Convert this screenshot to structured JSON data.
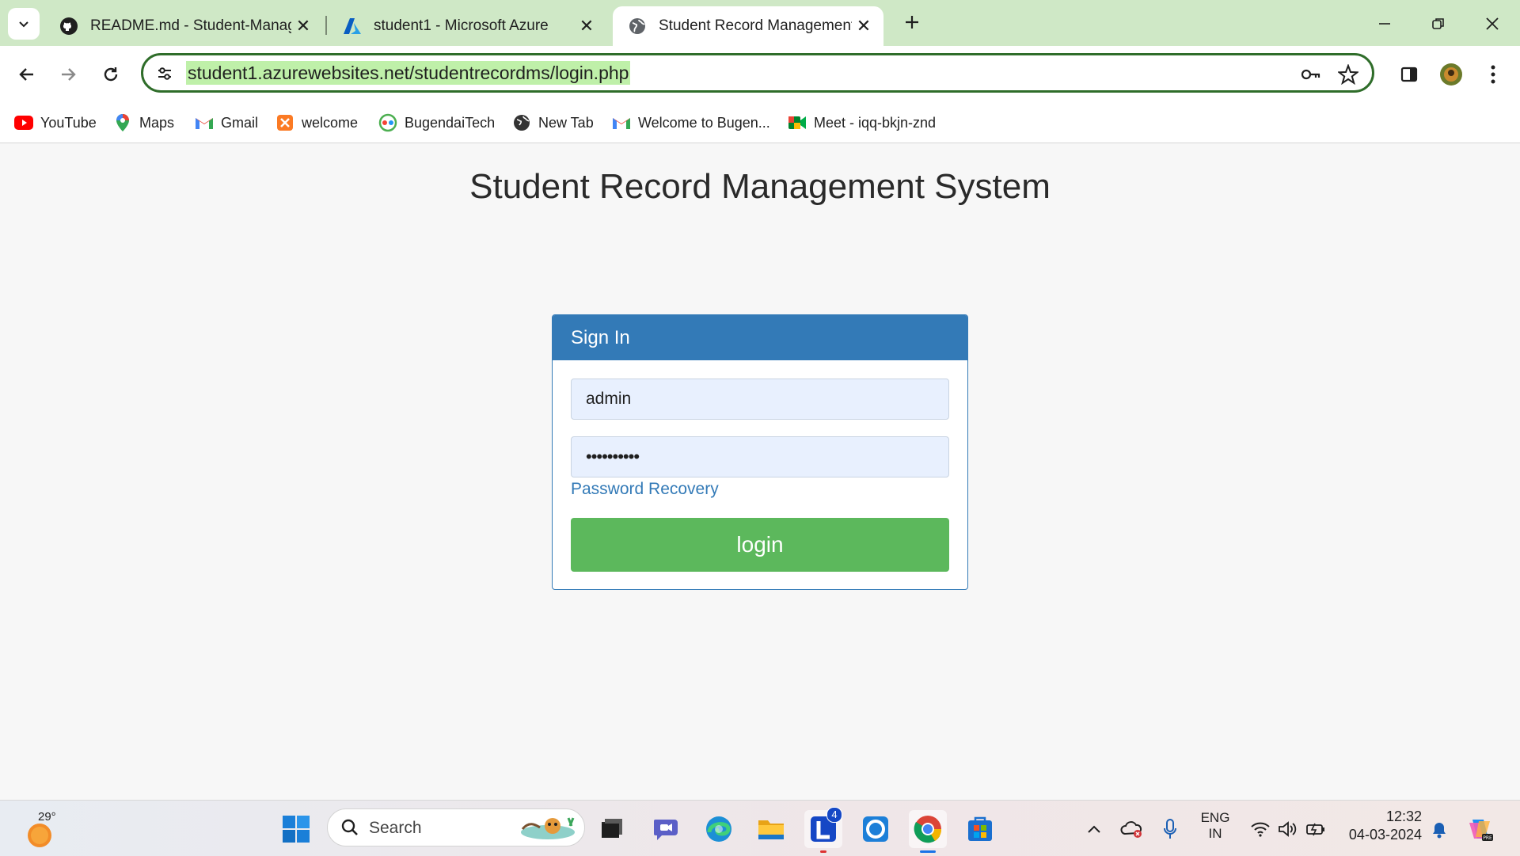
{
  "browser": {
    "tabs": [
      {
        "title": "README.md - Student-Manage",
        "icon": "github-icon",
        "active": false
      },
      {
        "title": "student1 - Microsoft Azure",
        "icon": "azure-icon",
        "active": false
      },
      {
        "title": "Student Record Management Sy",
        "icon": "globe-icon",
        "active": true
      }
    ],
    "url": "student1.azurewebsites.net/studentrecordms/login.php"
  },
  "bookmarks": [
    {
      "label": "YouTube",
      "icon": "youtube-icon",
      "color": "#ff0000"
    },
    {
      "label": "Maps",
      "icon": "maps-icon",
      "color": "#34a853"
    },
    {
      "label": "Gmail",
      "icon": "gmail-icon",
      "color": "#ea4335"
    },
    {
      "label": "welcome",
      "icon": "xampp-icon",
      "color": "#fb7a24"
    },
    {
      "label": "BugendaiTech",
      "icon": "bugendaitech-icon",
      "color": "#4caf50"
    },
    {
      "label": "New Tab",
      "icon": "globe-icon",
      "color": "#333333"
    },
    {
      "label": "Welcome to Bugen...",
      "icon": "gmail-icon",
      "color": "#ea4335"
    },
    {
      "label": "Meet - iqq-bkjn-znd",
      "icon": "meet-icon",
      "color": "#00832d"
    }
  ],
  "page": {
    "title": "Student Record Management System",
    "panel_heading": "Sign In",
    "username_value": "admin",
    "password_value": "••••••••••",
    "password_recovery_link": "Password Recovery",
    "login_button": "login"
  },
  "taskbar": {
    "weather_temp": "29°",
    "search_label": "Search",
    "lang_line1": "ENG",
    "lang_line2": "IN",
    "time": "12:32",
    "date": "04-03-2024",
    "mail_badge": "4"
  },
  "colors": {
    "panel_primary": "#337ab7",
    "login_green": "#5cb85c",
    "tabstrip_bg": "#cfe8c6",
    "url_highlight": "#bff0a9"
  }
}
